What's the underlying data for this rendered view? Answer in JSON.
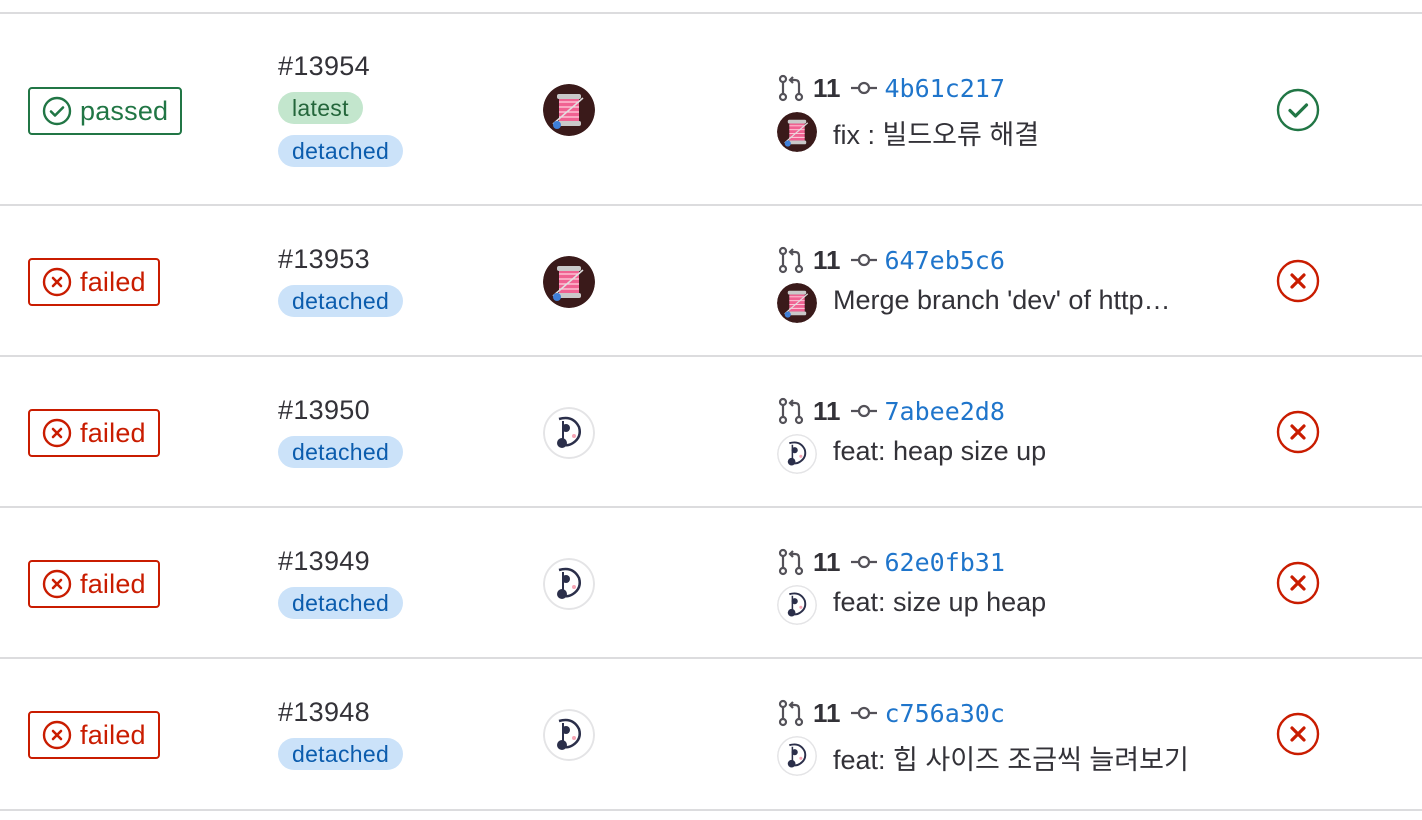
{
  "pipelines": [
    {
      "status": "passed",
      "id": "#13954",
      "tags": [
        "latest",
        "detached"
      ],
      "avatar": "spool-avatar",
      "mr_count": "11",
      "sha": "4b61c217",
      "message": "fix : 빌드오류 해결",
      "stage": "passed"
    },
    {
      "status": "failed",
      "id": "#13953",
      "tags": [
        "detached"
      ],
      "avatar": "spool-avatar",
      "mr_count": "11",
      "sha": "647eb5c6",
      "message": "Merge branch 'dev' of http…",
      "stage": "failed"
    },
    {
      "status": "failed",
      "id": "#13950",
      "tags": [
        "detached"
      ],
      "avatar": "panda-avatar",
      "mr_count": "11",
      "sha": "7abee2d8",
      "message": "feat: heap size up",
      "stage": "failed"
    },
    {
      "status": "failed",
      "id": "#13949",
      "tags": [
        "detached"
      ],
      "avatar": "panda-avatar",
      "mr_count": "11",
      "sha": "62e0fb31",
      "message": "feat: size up heap",
      "stage": "failed"
    },
    {
      "status": "failed",
      "id": "#13948",
      "tags": [
        "detached"
      ],
      "avatar": "panda-avatar",
      "mr_count": "11",
      "sha": "c756a30c",
      "message": "feat: 힙 사이즈 조금씩 늘려보기",
      "stage": "failed"
    }
  ],
  "icons": {
    "passed": "check-circle-icon",
    "failed": "close-circle-icon",
    "merge_request": "merge-request-icon",
    "commit": "commit-icon"
  },
  "colors": {
    "passed": "#217645",
    "failed": "#c91c00",
    "sha_link": "#1f75cb",
    "latest_bg": "#c3e6cd",
    "detached_bg": "#cbe2f9",
    "divider": "#dcdcde"
  }
}
